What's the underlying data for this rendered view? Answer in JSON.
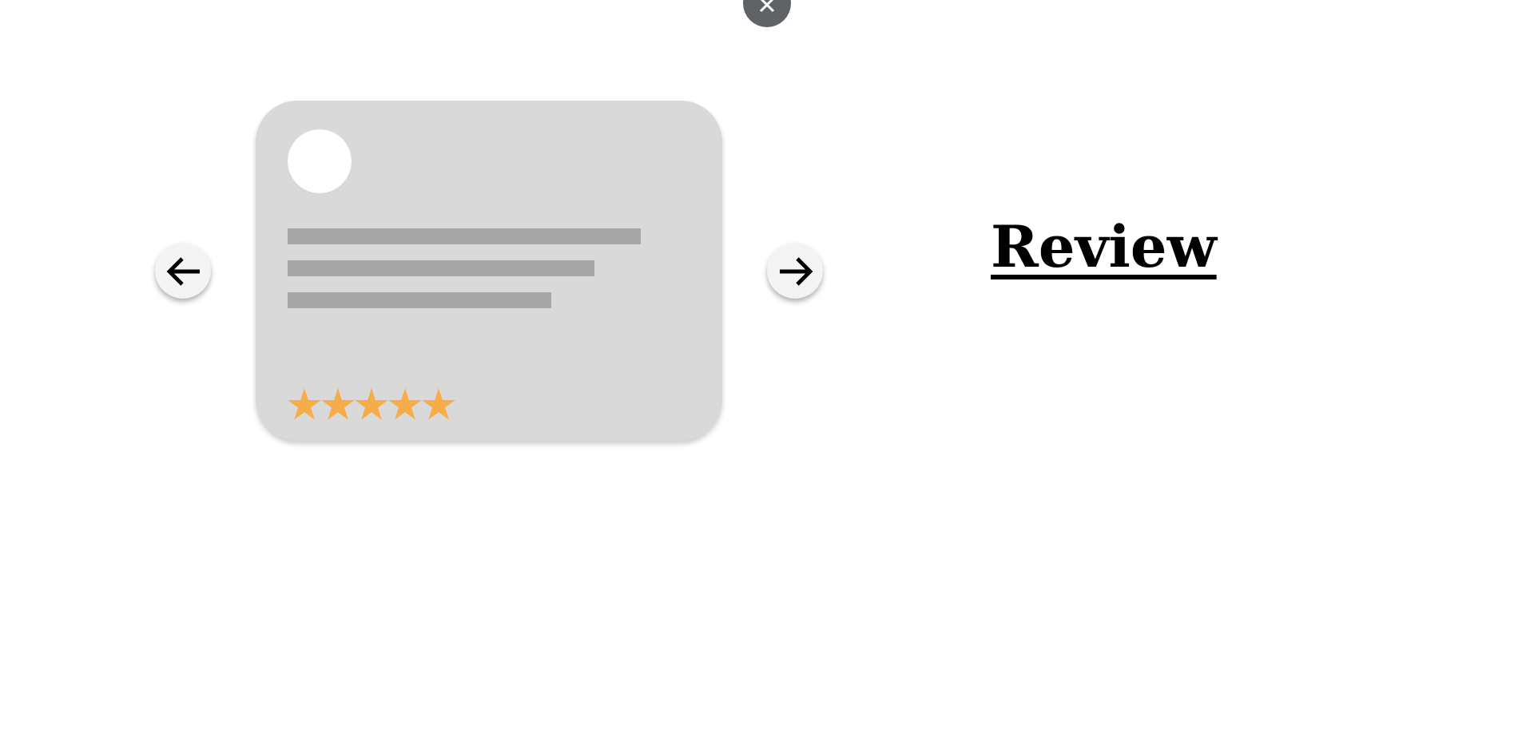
{
  "card": {
    "stars": 5
  },
  "heading": "Review"
}
